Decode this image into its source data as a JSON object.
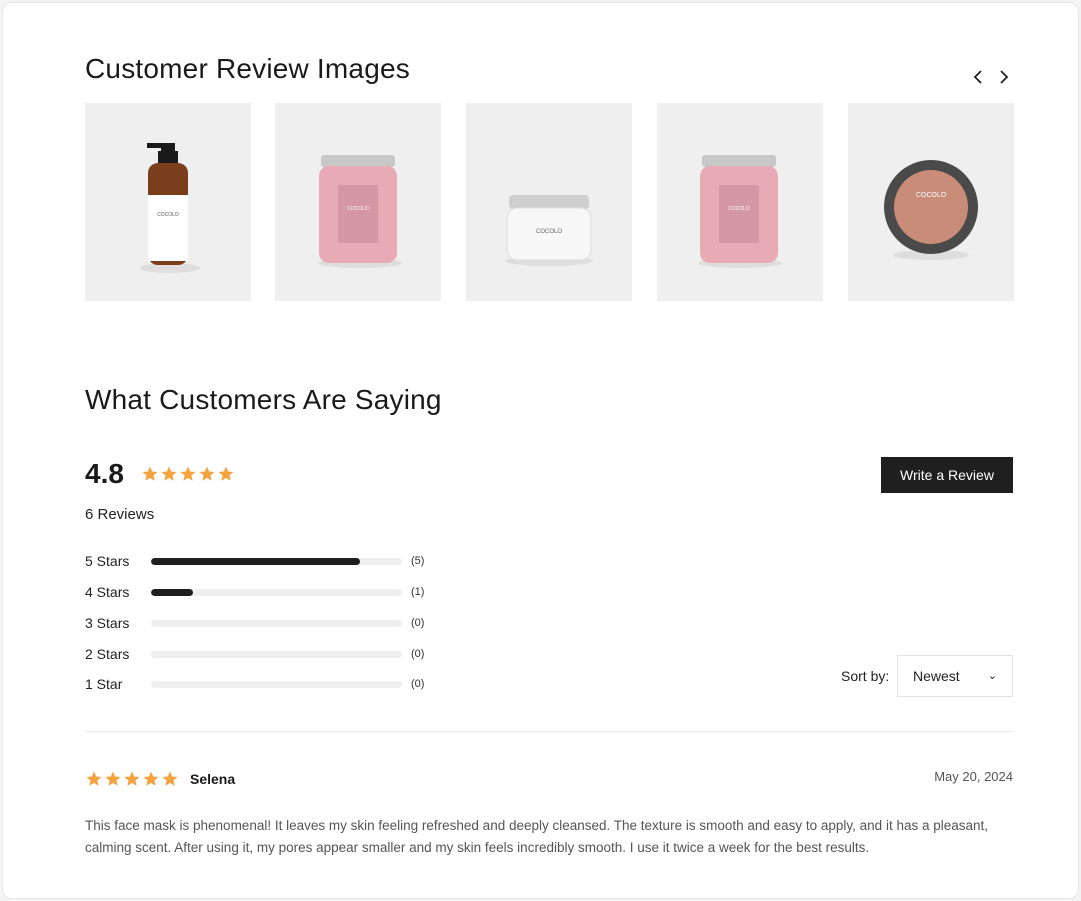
{
  "gallery": {
    "title": "Customer Review Images",
    "images": [
      {
        "icon": "pump-bottle-image",
        "label": "COCOLO"
      },
      {
        "icon": "pink-jar-image",
        "label": "COCOLO"
      },
      {
        "icon": "white-jar-image",
        "label": "COCOLO"
      },
      {
        "icon": "pink-jar-image",
        "label": "COCOLO"
      },
      {
        "icon": "round-tin-image",
        "label": "COCOLO"
      }
    ]
  },
  "reviews": {
    "title": "What Customers Are Saying",
    "average": "4.8",
    "average_stars": 5,
    "count_label": "6 Reviews",
    "write_button": "Write a Review",
    "distribution": [
      {
        "label": "5 Stars",
        "count": "(5)",
        "fraction": 0.833
      },
      {
        "label": "4 Stars",
        "count": "(1)",
        "fraction": 0.167
      },
      {
        "label": "3 Stars",
        "count": "(0)",
        "fraction": 0
      },
      {
        "label": "2 Stars",
        "count": "(0)",
        "fraction": 0
      },
      {
        "label": "1 Star",
        "count": "(0)",
        "fraction": 0
      }
    ],
    "sort": {
      "label": "Sort by:",
      "value": "Newest"
    },
    "items": [
      {
        "name": "Selena",
        "stars": 5,
        "date": "May 20, 2024",
        "body": "This face mask is phenomenal! It leaves my skin feeling refreshed and deeply cleansed. The texture is smooth and easy to apply, and it has a pleasant, calming scent. After using it, my pores appear smaller and my skin feels incredibly smooth. I use it twice a week for the best results."
      }
    ]
  },
  "colors": {
    "star": "#f4a340",
    "button_bg": "#1f1f1f",
    "bar_fill": "#1f1f1f",
    "bar_track": "#efefef"
  }
}
